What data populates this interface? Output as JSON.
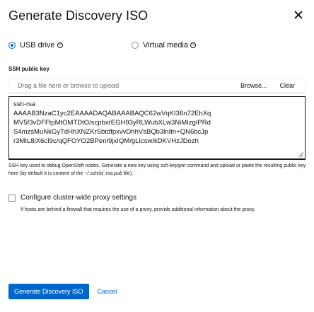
{
  "modal": {
    "title": "Generate Discovery ISO"
  },
  "boot_options": {
    "usb_drive_label": "USB drive",
    "usb_drive_selected": true,
    "virtual_media_label": "Virtual media",
    "virtual_media_selected": false
  },
  "ssh": {
    "section_label": "SSH public key",
    "upload_placeholder": "Drag a file here or browse to upload",
    "browse_label": "Browse...",
    "clear_label": "Clear",
    "key_lines": [
      "ssh-rsa",
      "AAAAB3NzaC1yc2EAAAADAQABAAABAQC62wVqKI36n72EhXq",
      "MV5f3vDFFtpMtOMTDtO/scpbxrEGH93yRLWubXLw3NiMIzgIPRd",
      "S4mzsMuNkGyTdHhXNZKrSbtdfpxvvDhhVsBQb3lnItn+QN6bcJp",
      "r3MIL8iX6cI9c/qQFOYO2BPenI9jxIQM/gLIcsw/kDKVHzJDozh"
    ],
    "helper_text_1": "SSH key used to debug OpenShift nodes. Generate a new key using ",
    "helper_cmd": "ssh-keygen",
    "helper_text_2": " command and upload or paste the resulting public key here (by default it is content of the ",
    "helper_path": "~/.ssh/id_rsa.pub",
    "helper_text_3": " file)."
  },
  "proxy": {
    "checkbox_label": "Configure cluster-wide proxy settings",
    "checked": false,
    "description": "If hosts are behind a firewall that requires the use of a proxy, provide additional information about the proxy."
  },
  "footer": {
    "primary_label": "Generate Discovery ISO",
    "cancel_label": "Cancel"
  },
  "colors": {
    "accent": "#0066cc",
    "text": "#151515",
    "muted": "#6a6e73"
  }
}
